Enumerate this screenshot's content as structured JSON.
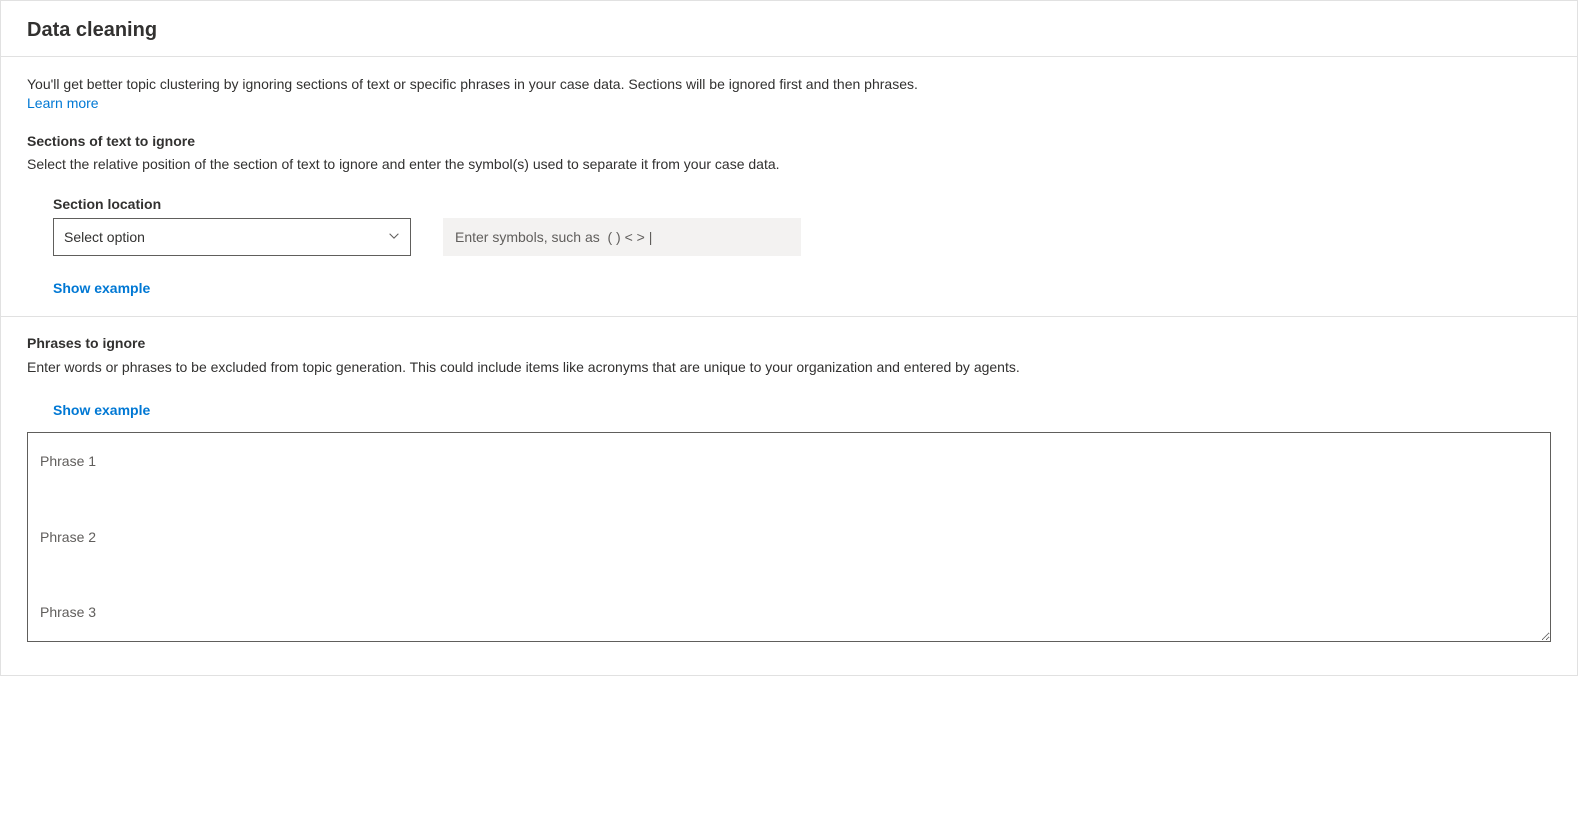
{
  "header": {
    "title": "Data cleaning"
  },
  "intro": {
    "description": "You'll get better topic clustering by ignoring sections of text or specific phrases in your case data. Sections will be ignored first and then phrases.",
    "learn_more": "Learn more"
  },
  "sections_to_ignore": {
    "heading": "Sections of text to ignore",
    "description": "Select the relative position of the section of text to ignore and enter the symbol(s) used to separate it from your case data.",
    "location_label": "Section location",
    "select_placeholder": "Select option",
    "symbols_placeholder": "Enter symbols, such as  ( ) < > |",
    "show_example": "Show example"
  },
  "phrases_to_ignore": {
    "heading": "Phrases to ignore",
    "description": "Enter words or phrases to be excluded from topic generation. This could include items like acronyms that are unique to your organization and entered by agents.",
    "show_example": "Show example",
    "textarea_placeholder": "Phrase 1\n\nPhrase 2\n\nPhrase 3"
  }
}
